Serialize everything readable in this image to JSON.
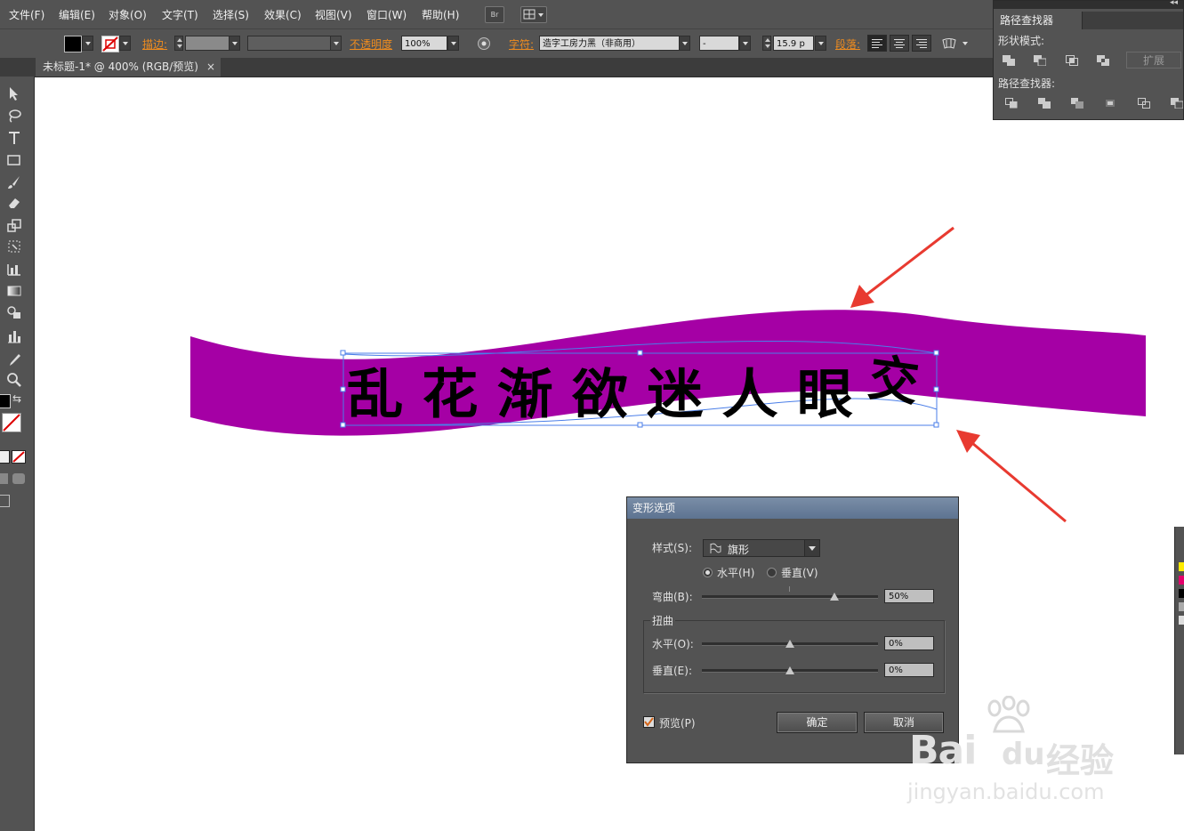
{
  "menu": {
    "items": [
      "文件(F)",
      "编辑(E)",
      "对象(O)",
      "文字(T)",
      "选择(S)",
      "效果(C)",
      "视图(V)",
      "窗口(W)",
      "帮助(H)"
    ],
    "bridge_label": "Br"
  },
  "control_bar": {
    "stroke_label": "描边:",
    "opacity_label": "不透明度",
    "opacity_value": "100%",
    "character_label": "字符:",
    "font_name": "造字工房力黑（非商用）",
    "font_style": "-",
    "font_size": "15.9 p",
    "paragraph_label": "段落:"
  },
  "document": {
    "tab_title": "未标题-1* @ 400% (RGB/预览)",
    "close_glyph": "×",
    "ribbon_text": "乱花渐欲迷人眼",
    "ribbon_text_last": "交",
    "ribbon_color": "#a500a5"
  },
  "pathfinder_panel": {
    "title": "路径查找器",
    "shape_modes_label": "形状模式:",
    "expand_label": "扩展",
    "pathfinders_label": "路径查找器:"
  },
  "warp_dialog": {
    "title": "变形选项",
    "style_label": "样式(S):",
    "style_value": "旗形",
    "horizontal_label": "水平(H)",
    "vertical_label": "垂直(V)",
    "orientation_selected": "horizontal",
    "bend_label": "弯曲(B):",
    "bend_value": "50%",
    "bend_fraction": 0.5,
    "distortion_group": "扭曲",
    "dist_h_label": "水平(O):",
    "dist_h_value": "0%",
    "dist_h_fraction": 0,
    "dist_v_label": "垂直(E):",
    "dist_v_value": "0%",
    "dist_v_fraction": 0,
    "preview_label": "预览(P)",
    "preview_checked": true,
    "ok_label": "确定",
    "cancel_label": "取消"
  },
  "watermark": {
    "brand": "Bai",
    "brand_suffix": "du",
    "cn": "经验",
    "url": "jingyan.baidu.com"
  },
  "colors": {
    "ui_bg": "#535353",
    "accent_orange": "#f08c1e",
    "annotation_arrow": "#e83a30",
    "selection_blue": "#4a7ee8"
  }
}
